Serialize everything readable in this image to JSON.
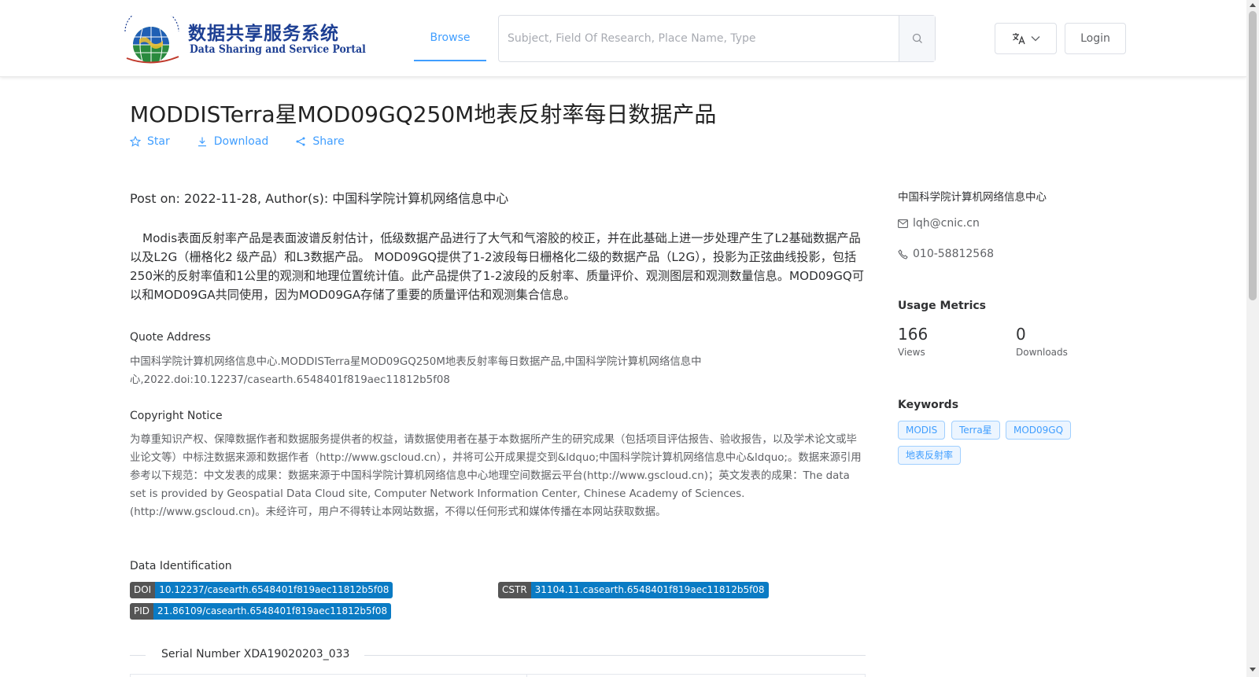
{
  "header": {
    "logo_cn": "数据共享服务系统",
    "logo_en": "Data Sharing and Service Portal",
    "nav_browse": "Browse",
    "search_placeholder": "Subject, Field Of Research, Place Name, Type",
    "login": "Login"
  },
  "dataset": {
    "title": "MODDISTerra星MOD09GQ250M地表反射率每日数据产品",
    "actions": {
      "star": "Star",
      "download": "Download",
      "share": "Share"
    },
    "post_on": "Post on: 2022-11-28, Author(s): 中国科学院计算机网络信息中心",
    "description": "Modis表面反射率产品是表面波谱反射估计，低级数据产品进行了大气和气溶胶的校正，并在此基础上进一步处理产生了L2基础数据产品以及L2G（栅格化2 级产品）和L3数据产品。 MOD09GQ提供了1-2波段每日栅格化二级的数据产品（L2G），投影为正弦曲线投影，包括250米的反射率值和1公里的观测和地理位置统计值。此产品提供了1-2波段的反射率、质量评价、观测图层和观测数量信息。MOD09GQ可以和MOD09GA共同使用，因为MOD09GA存储了重要的质量评估和观测集合信息。",
    "quote_label": "Quote Address",
    "quote_text": "中国科学院计算机网络信息中心.MODDISTerra星MOD09GQ250M地表反射率每日数据产品,中国科学院计算机网络信息中心,2022.doi:10.12237/casearth.6548401f819aec11812b5f08",
    "copyright_label": "Copyright Notice",
    "copyright_text": "为尊重知识产权、保障数据作者和数据服务提供者的权益，请数据使用者在基于本数据所产生的研究成果（包括项目评估报告、验收报告，以及学术论文或毕业论文等）中标注数据来源和数据作者（http://www.gscloud.cn），并将可公开成果提交到&ldquo;中国科学院计算机网络信息中心&ldquo;。数据来源引用参考以下规范：中文发表的成果：数据来源于中国科学院计算机网络信息中心地理空间数据云平台(http://www.gscloud.cn)；英文发表的成果：The data set is provided by Geospatial Data Cloud site, Computer Network Information Center, Chinese Academy of Sciences. (http://www.gscloud.cn)。未经许可，用户不得转让本网站数据，不得以任何形式和媒体传播在本网站获取数据。",
    "identification_label": "Data Identification",
    "doi_key": "DOI",
    "doi_value": "10.12237/casearth.6548401f819aec11812b5f08",
    "cstr_key": "CSTR",
    "cstr_value": "31104.11.casearth.6548401f819aec11812b5f08",
    "pid_key": "PID",
    "pid_value": "21.86109/casearth.6548401f819aec11812b5f08",
    "serial_number": "Serial Number XDA19020203_033"
  },
  "sidebar": {
    "org": "中国科学院计算机网络信息中心",
    "email": "lqh@cnic.cn",
    "phone": "010-58812568",
    "usage_heading": "Usage Metrics",
    "views_count": "166",
    "views_label": "Views",
    "downloads_count": "0",
    "downloads_label": "Downloads",
    "keywords_heading": "Keywords",
    "keywords": [
      "MODIS",
      "Terra星",
      "MOD09GQ",
      "地表反射率"
    ]
  },
  "colors": {
    "accent": "#409eff",
    "logo_blue": "#1d3f93",
    "id_value_bg": "#0a7bc4",
    "id_key_bg": "#555555"
  },
  "icons": {
    "logo": "globe-logo",
    "search": "search-icon",
    "language": "translate-icon",
    "star": "star-icon",
    "download": "download-icon",
    "share": "share-icon",
    "email": "mail-icon",
    "phone": "phone-icon"
  }
}
